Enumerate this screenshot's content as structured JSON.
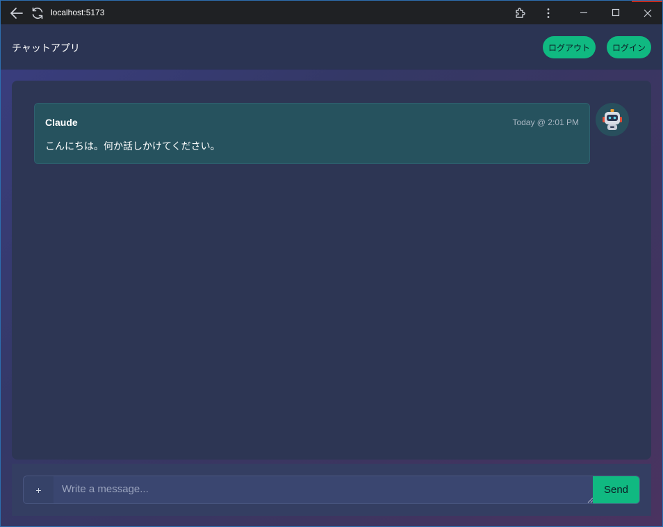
{
  "browser": {
    "url": "localhost:5173",
    "icons": [
      "back-arrow-icon",
      "reload-icon",
      "extensions-icon",
      "more-vertical-icon",
      "minimize-icon",
      "maximize-icon",
      "close-icon"
    ]
  },
  "header": {
    "title": "チャットアプリ",
    "logout_label": "ログアウト",
    "login_label": "ログイン"
  },
  "messages": [
    {
      "author": "Claude",
      "time": "Today @ 2:01 PM",
      "text": "こんにちは。何か話しかけてください。",
      "avatar_icon": "robot-icon"
    }
  ],
  "composer": {
    "attach_label": "+",
    "placeholder": "Write a message...",
    "value": "",
    "send_label": "Send"
  },
  "colors": {
    "accent": "#10b981",
    "panel": "#2d3654",
    "message_bg": "#26525e"
  }
}
